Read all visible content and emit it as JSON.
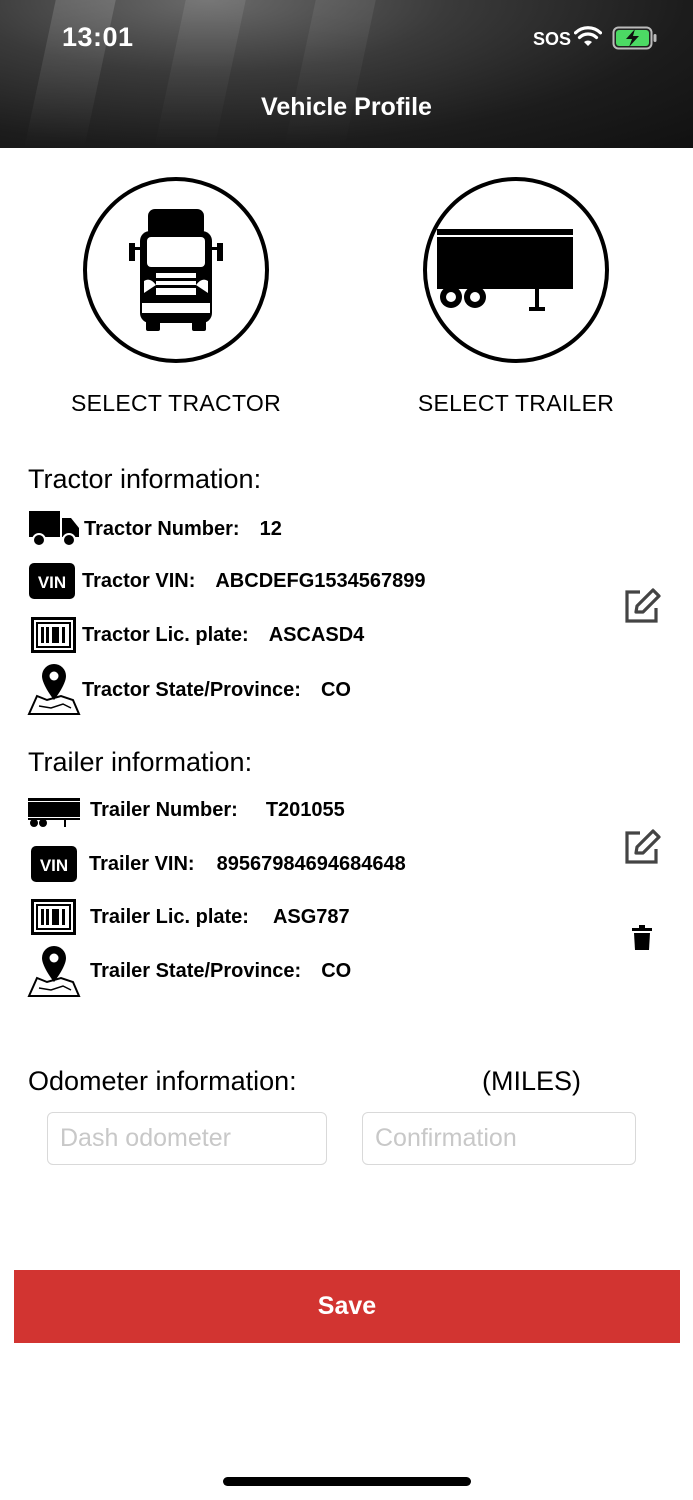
{
  "status_bar": {
    "time": "13:01",
    "sos": "SOS"
  },
  "header": {
    "title": "Vehicle Profile"
  },
  "selectors": {
    "tractor_label": "SELECT TRACTOR",
    "trailer_label": "SELECT TRAILER"
  },
  "tractor": {
    "section_title": "Tractor information:",
    "rows": [
      {
        "icon": "truck-icon",
        "label": "Tractor Number:",
        "value": "12"
      },
      {
        "icon": "vin-icon",
        "label": "Tractor VIN:",
        "value": "ABCDEFG1534567899"
      },
      {
        "icon": "license-plate-icon",
        "label": "Tractor Lic. plate:",
        "value": "ASCASD4"
      },
      {
        "icon": "map-pin-icon",
        "label": "Tractor State/Province:",
        "value": "CO"
      }
    ]
  },
  "trailer": {
    "section_title": "Trailer information:",
    "rows": [
      {
        "icon": "trailer-icon",
        "label": "Trailer Number:",
        "value": "T201055"
      },
      {
        "icon": "vin-icon",
        "label": "Trailer VIN:",
        "value": "89567984694684648"
      },
      {
        "icon": "license-plate-icon",
        "label": "Trailer Lic. plate:",
        "value": "ASG787"
      },
      {
        "icon": "map-pin-icon",
        "label": "Trailer State/Province:",
        "value": "CO"
      }
    ]
  },
  "icons": {
    "vin_text": "VIN"
  },
  "odometer": {
    "title": "Odometer information:",
    "unit": "(MILES)",
    "dash_placeholder": "Dash odometer",
    "confirm_placeholder": "Confirmation"
  },
  "actions": {
    "save_label": "Save"
  },
  "colors": {
    "accent": "#d23431",
    "header_bg": "#1c1c1c",
    "battery": "#4cd964"
  }
}
